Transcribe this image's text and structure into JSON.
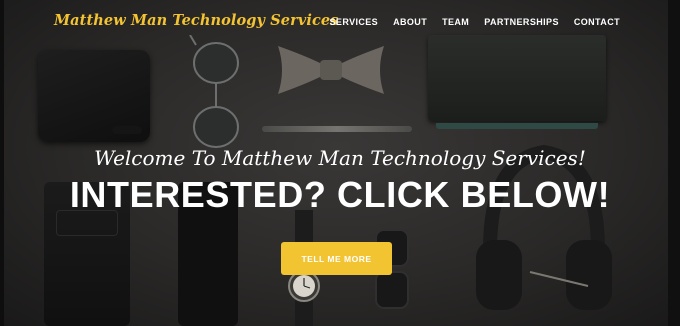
{
  "navbar": {
    "brand": "Matthew Man Technology Services",
    "links": [
      "SERVICES",
      "ABOUT",
      "TEAM",
      "PARTNERSHIPS",
      "CONTACT"
    ]
  },
  "hero": {
    "subheading": "Welcome To Matthew Man Technology Services!",
    "heading": "INTERESTED? CLICK BELOW!",
    "cta_label": "TELL ME MORE"
  },
  "colors": {
    "accent": "#f2c432",
    "background": "#2a2928",
    "text": "#ffffff"
  }
}
